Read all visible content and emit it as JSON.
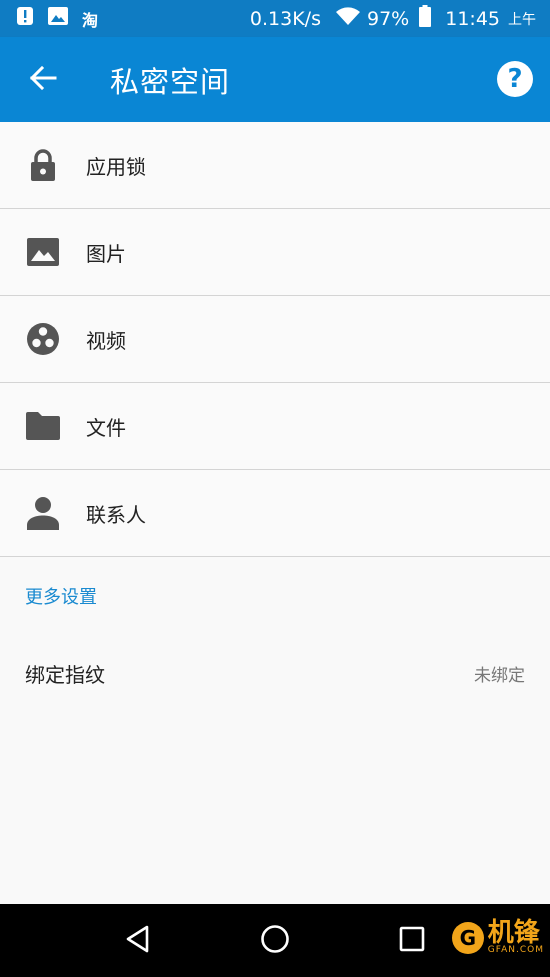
{
  "status_bar": {
    "taobao_label": "淘",
    "net_speed": "0.13K/s",
    "battery": "97%",
    "time": "11:45",
    "ampm": "上午",
    "icons": [
      "notification-alert-icon",
      "image-icon",
      "wifi-icon",
      "battery-icon"
    ]
  },
  "app_bar": {
    "title": "私密空间",
    "help_label": "?",
    "icons": [
      "arrow-back-icon",
      "help-icon"
    ]
  },
  "list": {
    "items": [
      {
        "label": "应用锁",
        "icon": "lock-icon"
      },
      {
        "label": "图片",
        "icon": "image-icon"
      },
      {
        "label": "视频",
        "icon": "video-reel-icon"
      },
      {
        "label": "文件",
        "icon": "folder-icon"
      },
      {
        "label": "联系人",
        "icon": "person-icon"
      }
    ]
  },
  "more_settings": {
    "header": "更多设置",
    "fingerprint": {
      "label": "绑定指纹",
      "value": "未绑定"
    }
  },
  "watermark": {
    "text": "机锋",
    "sub": "GFAN.COM",
    "logo_letter": "G"
  },
  "colors": {
    "status_bar": "#0f7cc3",
    "app_bar": "#0a86d4",
    "accent_text": "#1a8ad0",
    "icon_gray": "#555555"
  }
}
